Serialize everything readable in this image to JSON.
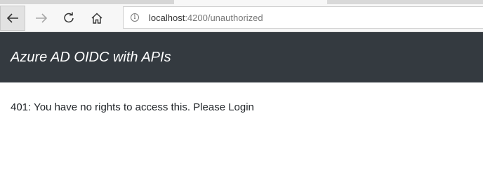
{
  "browser": {
    "url_host": "localhost",
    "url_path": ":4200/unauthorized",
    "icons": {
      "back": "arrow-left-icon",
      "forward": "arrow-right-icon",
      "refresh": "refresh-icon",
      "home": "home-icon",
      "site_info": "info-icon"
    }
  },
  "navbar": {
    "brand": "Azure AD OIDC with APIs",
    "background": "#343a40"
  },
  "main": {
    "message": "401: You have no rights to access this. Please Login"
  }
}
